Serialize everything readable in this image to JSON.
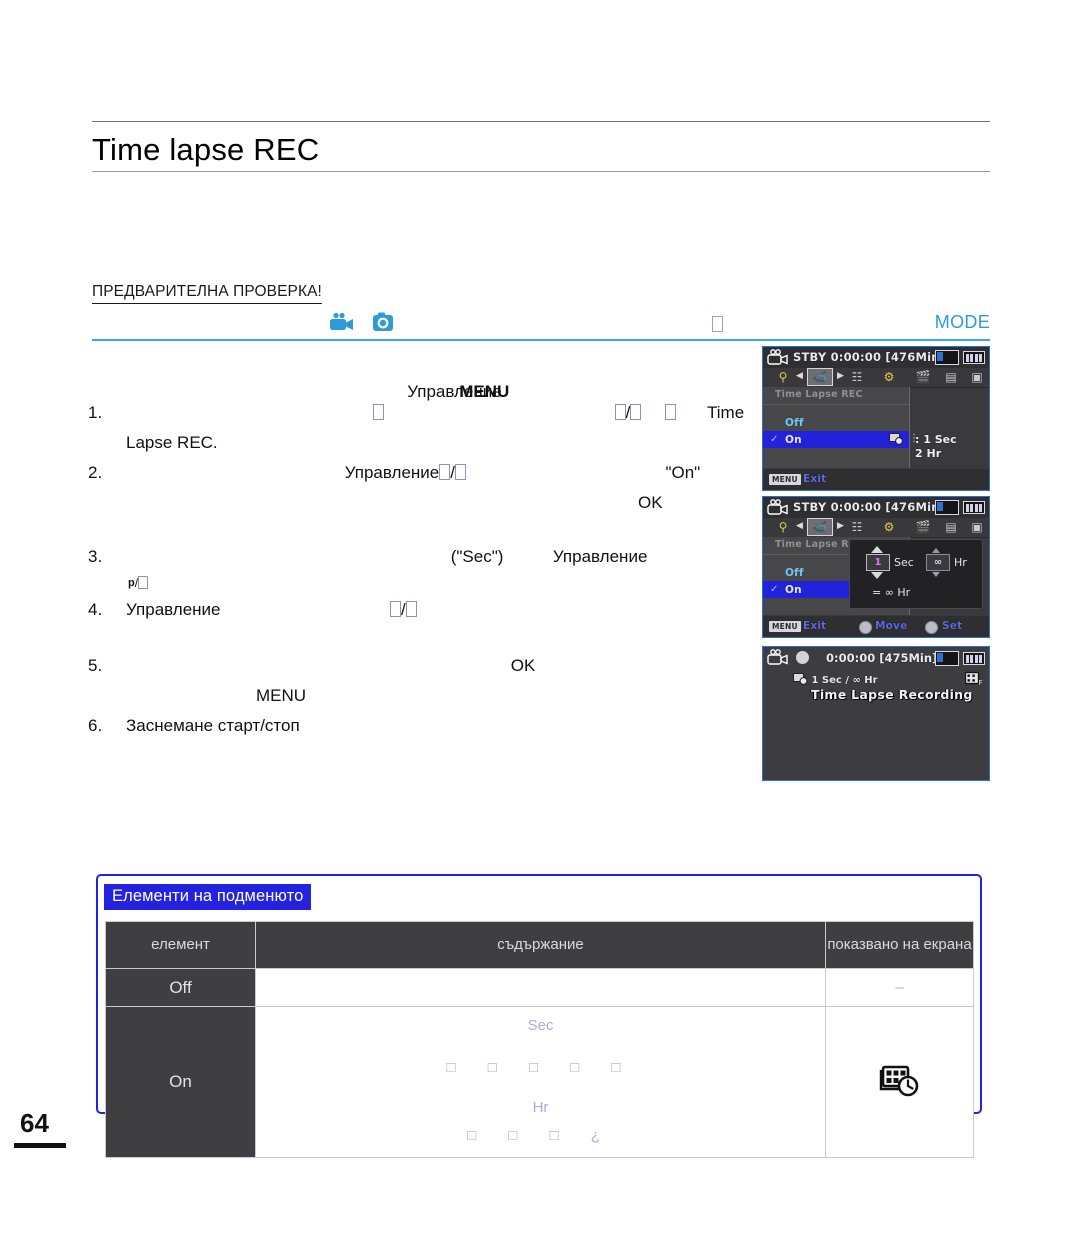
{
  "header": {
    "title": "Time lapse REC"
  },
  "precheck": {
    "label": "ПРЕДВАРИТЕЛНА ПРОВЕРКА!",
    "icons": [
      "camcorder-icon",
      "photo-icon",
      "missing-glyph"
    ],
    "mode_label": "MODE",
    "accent_color": "#3aa8e8"
  },
  "steps": [
    {
      "num": "1.",
      "missing1": "",
      "word_control": "Управление",
      "word_menu": "MENU",
      "slash": "/",
      "word_time": "Time",
      "line2": "Lapse REC."
    },
    {
      "num": "2.",
      "word_control": "Управление",
      "slash": "/",
      "on_quoted": "\"On\"",
      "ok": "OK"
    },
    {
      "num": "3.",
      "sec_quoted": "(\"Sec\")",
      "word_control": "Управление",
      "p_label": "p",
      "slash": "/"
    },
    {
      "num": "4.",
      "word_control": "Управление",
      "slash": "/"
    },
    {
      "num": "5.",
      "ok": "OK",
      "menu": "MENU"
    },
    {
      "num": "6.",
      "line2": "Заснемане старт/стоп"
    }
  ],
  "lcd_panels": [
    {
      "name": "menu-on-off",
      "status": "STBY 0:00:00 [476Min]",
      "menu_title": "Time Lapse REC",
      "items": [
        {
          "label": "Off",
          "selected": false
        },
        {
          "label": "On",
          "selected": true
        }
      ],
      "side_values": [
        ": 1 Sec",
        "2 Hr"
      ],
      "bottom": {
        "menu_pill": "MENU",
        "exit": "Exit"
      }
    },
    {
      "name": "interval-dialog",
      "status": "STBY 0:00:00 [476Min]",
      "menu_title": "Time Lapse REC",
      "items": [
        {
          "label": "Off",
          "selected": false
        },
        {
          "label": "On",
          "selected": true
        }
      ],
      "dialog": {
        "sec_value": "1",
        "sec_label": "Sec",
        "hr_value": "∞",
        "hr_label": "Hr",
        "total": "= ∞ Hr"
      },
      "bottom": {
        "menu_pill": "MENU",
        "exit": "Exit",
        "move": "Move",
        "set": "Set"
      }
    },
    {
      "name": "recording",
      "time": "0:00:00 [475Min]",
      "interval": "1 Sec / ∞ Hr",
      "status_text": "Time Lapse Recording"
    }
  ],
  "submenu": {
    "tag": "Елементи на подменюто",
    "columns": [
      "елемент",
      "съдържание",
      "показвано на екрана"
    ],
    "rows": [
      {
        "item": "Off",
        "content_lines": [
          "",
          "",
          "",
          ""
        ],
        "screen": "–"
      },
      {
        "item": "On",
        "content_lines": [
          "Sec",
          "□ □ □ □ □",
          "Hr",
          "□ □ □ ¿"
        ],
        "screen": "timelapse-icon"
      }
    ]
  },
  "page": {
    "number": "64"
  }
}
